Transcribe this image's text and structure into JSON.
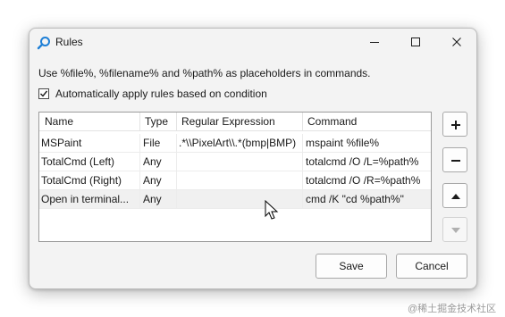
{
  "window": {
    "title": "Rules",
    "description": "Use %file%, %filename% and %path% as placeholders in commands.",
    "auto_apply": {
      "label": "Automatically apply rules based on condition",
      "checked": true
    }
  },
  "table": {
    "columns": [
      "Name",
      "Type",
      "Regular Expression",
      "Command"
    ],
    "rows": [
      [
        "MSPaint",
        "File",
        ".*\\\\PixelArt\\\\.*(bmp|BMP)",
        "mspaint %file%"
      ],
      [
        "TotalCmd (Left)",
        "Any",
        "",
        "totalcmd /O /L=%path%"
      ],
      [
        "TotalCmd (Right)",
        "Any",
        "",
        "totalcmd /O /R=%path%"
      ],
      [
        "Open in terminal...",
        "Any",
        "",
        "cmd /K \"cd %path%\""
      ]
    ],
    "selected_row": 3
  },
  "side_buttons": [
    {
      "icon": "plus-icon",
      "enabled": true
    },
    {
      "icon": "minus-icon",
      "enabled": true
    },
    {
      "icon": "arrow-up-icon",
      "enabled": true
    },
    {
      "icon": "arrow-down-icon",
      "enabled": false
    }
  ],
  "buttons": {
    "save": "Save",
    "cancel": "Cancel"
  },
  "watermark": "@稀土掘金技术社区",
  "colors": {
    "accent": "#0067c0",
    "window_bg": "#f3f3f3",
    "selected_row": "#f0f0f0"
  }
}
